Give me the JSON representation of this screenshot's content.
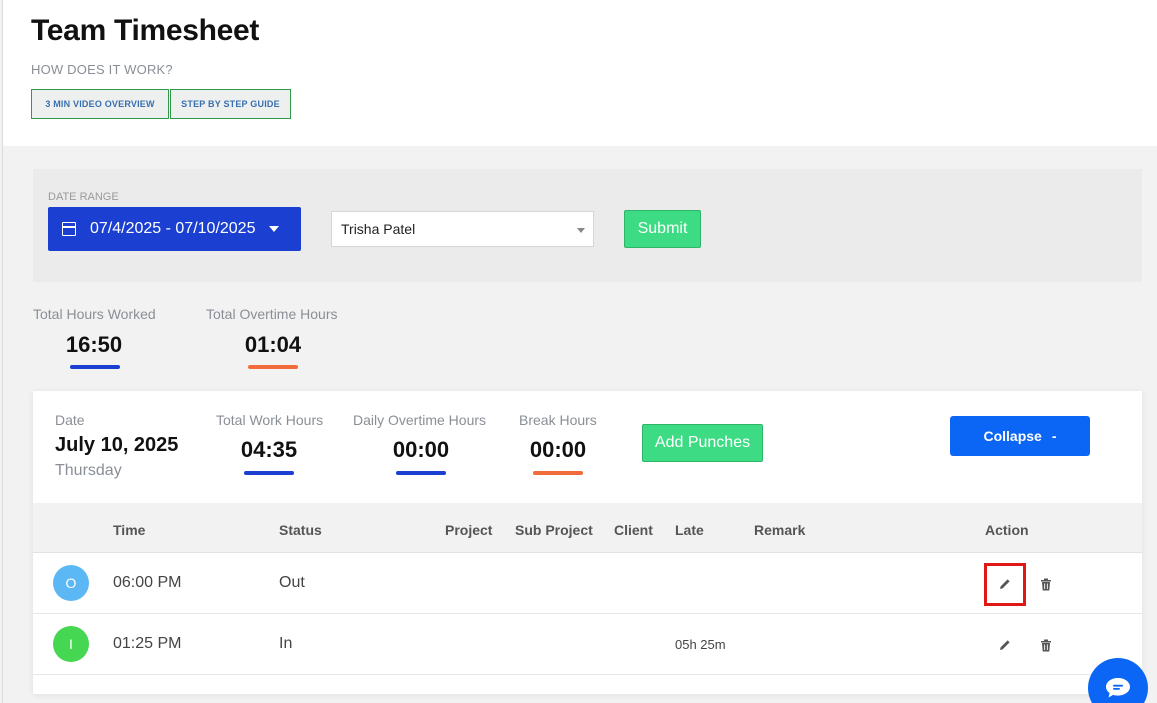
{
  "header": {
    "title": "Team Timesheet",
    "how_it_works": "HOW DOES IT WORK?",
    "video_btn": "3 MIN VIDEO OVERVIEW",
    "guide_btn": "STEP BY STEP GUIDE"
  },
  "filters": {
    "date_range_label": "DATE RANGE",
    "date_range_value": "07/4/2025 - 07/10/2025",
    "employee": "Trisha Patel",
    "submit_label": "Submit"
  },
  "summary": {
    "total_hours_label": "Total Hours Worked",
    "total_hours_value": "16:50",
    "overtime_label": "Total Overtime Hours",
    "overtime_value": "01:04"
  },
  "day": {
    "date_label": "Date",
    "date": "July 10, 2025",
    "weekday": "Thursday",
    "work_hours_label": "Total Work Hours",
    "work_hours_value": "04:35",
    "daily_overtime_label": "Daily Overtime Hours",
    "daily_overtime_value": "00:00",
    "break_label": "Break Hours",
    "break_value": "00:00",
    "add_punches_label": "Add Punches",
    "collapse_label": "Collapse",
    "collapse_symbol": "-"
  },
  "table": {
    "columns": [
      "Time",
      "Status",
      "Project",
      "Sub Project",
      "Client",
      "Late",
      "Remark",
      "Action"
    ],
    "rows": [
      {
        "avatar": "O",
        "avatar_color": "#5cb8f5",
        "time": "06:00 PM",
        "status": "Out",
        "late": ""
      },
      {
        "avatar": "I",
        "avatar_color": "#45d652",
        "time": "01:25 PM",
        "status": "In",
        "late": "05h 25m"
      }
    ]
  },
  "colors": {
    "primary": "#1a3fd1",
    "accent_blue": "#0b66f5",
    "green": "#3ddc84",
    "orange": "#f26b3a"
  }
}
